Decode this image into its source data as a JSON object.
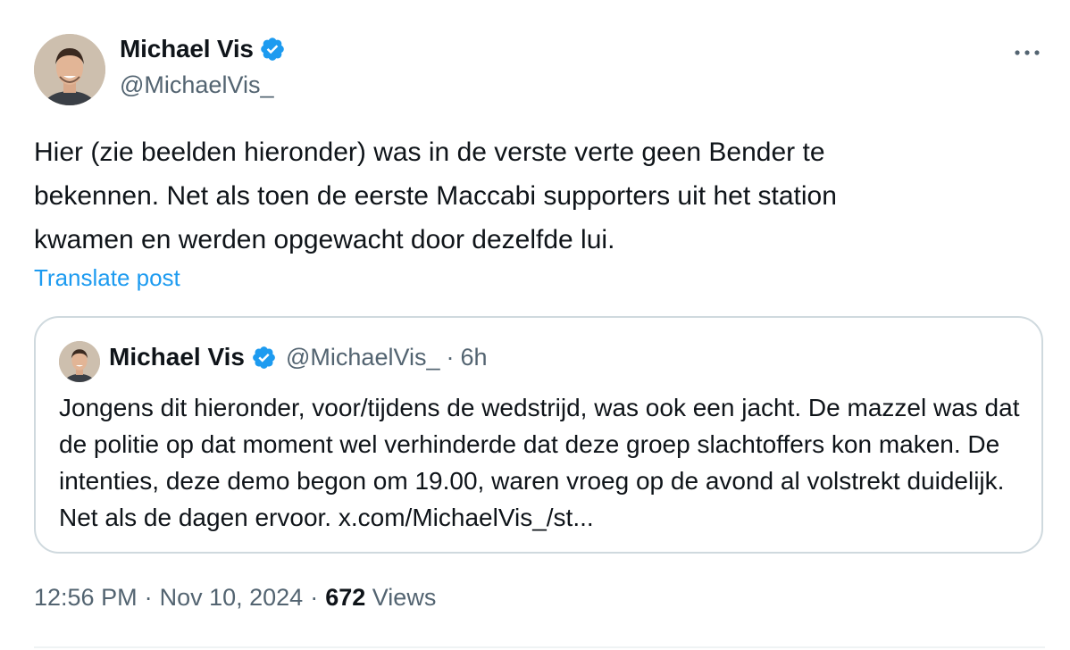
{
  "author": {
    "name": "Michael Vis",
    "handle": "@MichaelVis_",
    "verified": true
  },
  "tweet": {
    "text": "Hier (zie beelden hieronder) was in de verste verte geen Bender te\nbekennen. Net als toen de eerste Maccabi supporters uit het station\nkwamen en werden opgewacht door dezelfde lui.",
    "translate_label": "Translate post"
  },
  "quote": {
    "name": "Michael Vis",
    "handle": "@MichaelVis_",
    "separator": "·",
    "time": "6h",
    "text": "Jongens dit hieronder, voor/tijdens de wedstrijd, was ook een jacht. De mazzel was dat de politie op dat moment wel verhinderde dat deze groep slachtoffers kon maken. De intenties, deze demo begon om 19.00, waren vroeg op de avond al volstrekt duidelijk. Net als de dagen ervoor.",
    "link_text": "x.com/MichaelVis_/st..."
  },
  "meta": {
    "time": "12:56 PM",
    "separator": "·",
    "date": "Nov 10, 2024",
    "separator2": "·",
    "views_count": "672",
    "views_label": "Views"
  },
  "icons": {
    "more": "more-horizontal-icon",
    "verified": "verified-badge-icon"
  },
  "colors": {
    "accent": "#1d9bf0",
    "secondary_text": "#536471",
    "border": "#cfd9de"
  }
}
